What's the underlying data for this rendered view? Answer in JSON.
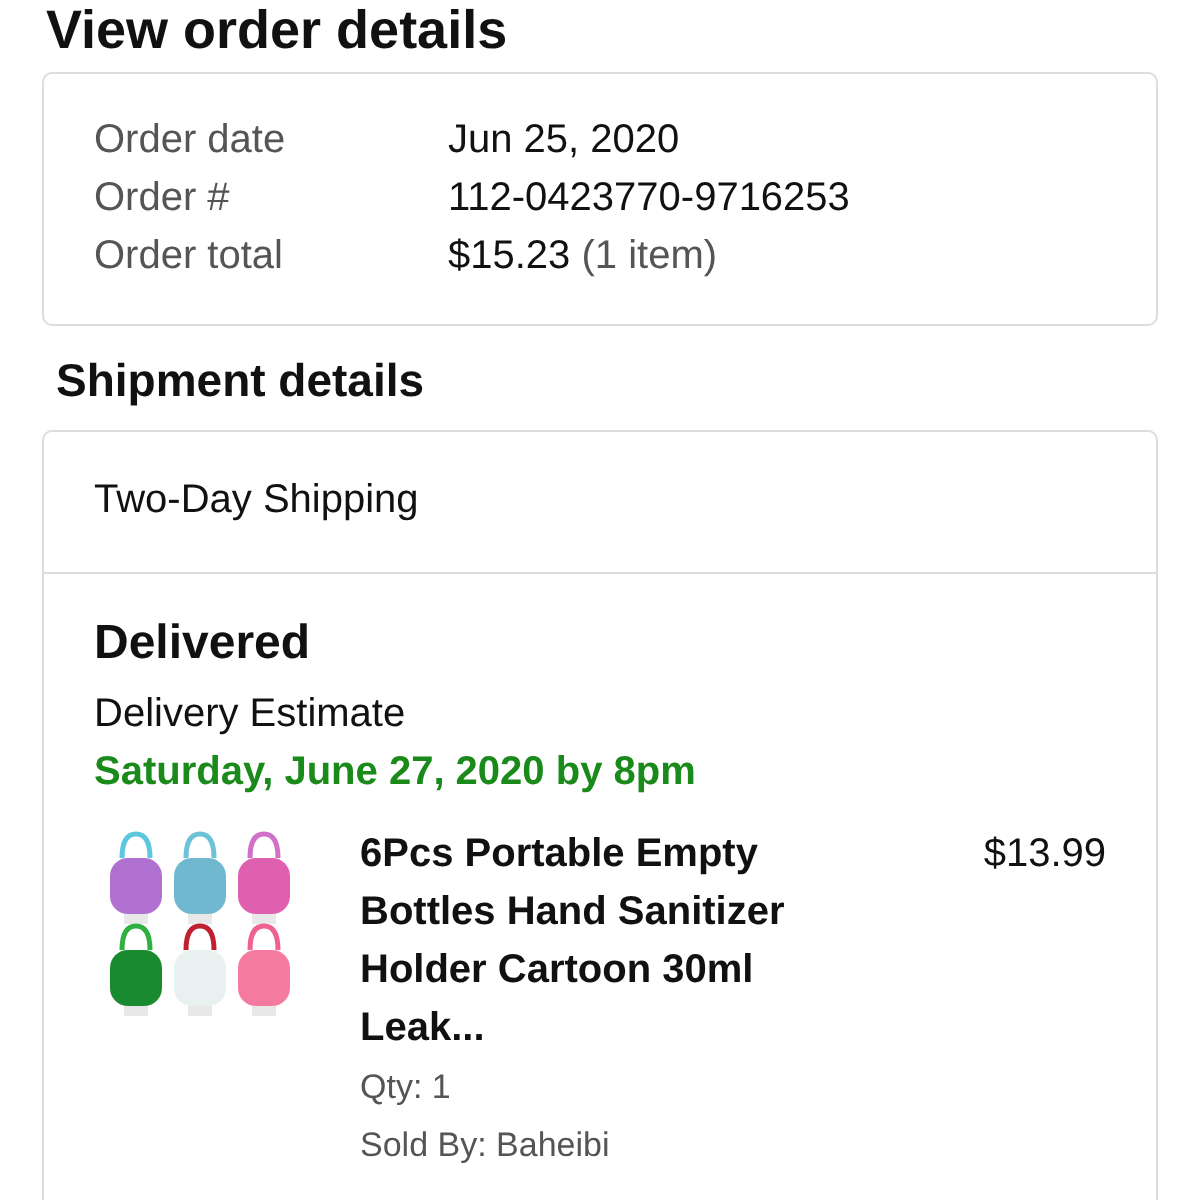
{
  "page_title": "View order details",
  "order_summary": {
    "rows": [
      {
        "label": "Order date",
        "value": "Jun 25, 2020"
      },
      {
        "label": "Order #",
        "value": "112-0423770-9716253"
      },
      {
        "label": "Order total",
        "value": "$15.23",
        "note": "(1 item)"
      }
    ]
  },
  "shipment": {
    "heading": "Shipment details",
    "shipping_method": "Two-Day Shipping",
    "status": "Delivered",
    "estimate_label": "Delivery Estimate",
    "estimate_date": "Saturday, June 27, 2020 by 8pm",
    "items": [
      {
        "title": "6Pcs Portable Empty Bottles Hand Sanitizer Holder Cartoon 30ml Leak...",
        "price": "$13.99",
        "qty": "Qty: 1",
        "sold_by": "Sold By: Baheibi"
      }
    ]
  }
}
